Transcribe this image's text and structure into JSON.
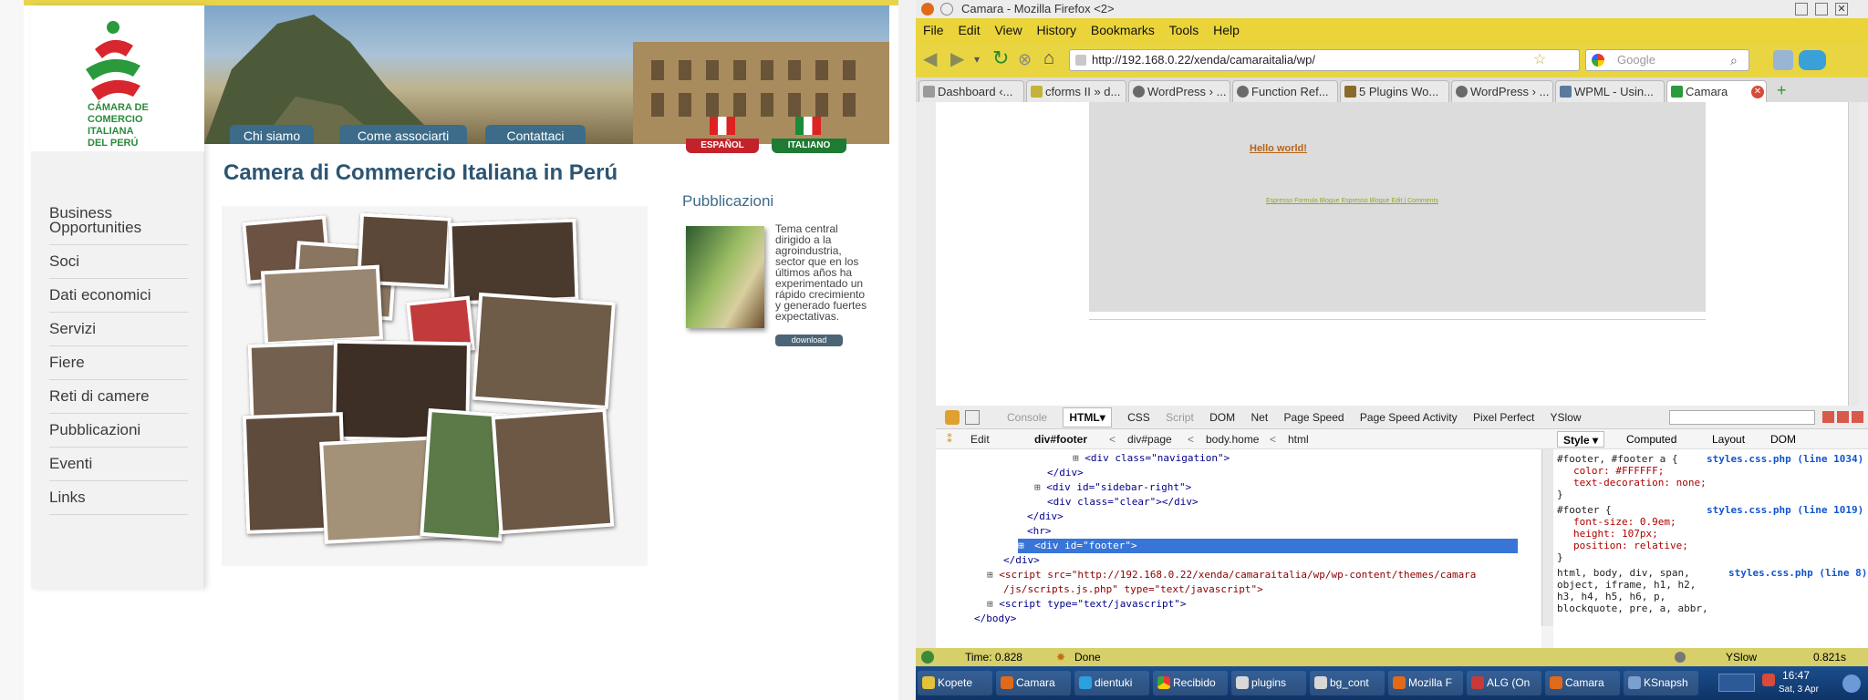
{
  "site": {
    "logo": {
      "line1": "CÁMARA DE",
      "line2": "COMERCIO",
      "line3": "ITALIANA",
      "line4": "DEL PERÚ"
    },
    "nav_tabs": [
      "Chi siamo",
      "Come associarti",
      "Contattaci"
    ],
    "languages": [
      "ESPAÑOL",
      "ITALIANO"
    ],
    "sidebar": [
      "Business Opportunities",
      "Soci",
      "Dati economici",
      "Servizi",
      "Fiere",
      "Reti di camere",
      "Pubblicazioni",
      "Eventi",
      "Links"
    ],
    "title": "Camera di Commercio Italiana in Perú",
    "publications": {
      "title": "Pubblicazioni",
      "description": "Tema central dirigido a la agroindustria, sector que en los últimos años ha experimentado un rápido crecimiento y generado fuertes expectativas.",
      "download": "download"
    }
  },
  "firefox": {
    "window_title": "Camara - Mozilla Firefox <2>",
    "menu": [
      "File",
      "Edit",
      "View",
      "History",
      "Bookmarks",
      "Tools",
      "Help"
    ],
    "url": "http://192.168.0.22/xenda/camaraitalia/wp/",
    "search_placeholder": "Google",
    "tabs": [
      "Dashboard ‹...",
      "cforms II » d...",
      "WordPress › ...",
      "Function Ref...",
      "5 Plugins Wo...",
      "WordPress › ...",
      "WPML - Usin...",
      "Camara"
    ],
    "page": {
      "hello": "Hello world!",
      "links": "Espresso Formula Blogue Espresso Blogue  Edit  | Comments"
    },
    "devtools": {
      "tabs": [
        "Console",
        "HTML",
        "CSS",
        "Script",
        "DOM",
        "Net",
        "Page Speed",
        "Page Speed Activity",
        "Pixel Perfect",
        "YSlow"
      ],
      "edit": "Edit",
      "breadcrumb": [
        "div#footer",
        "div#page",
        "body.home",
        "html"
      ],
      "side_tabs": [
        "Style",
        "Computed",
        "Layout",
        "DOM"
      ],
      "html_lines": [
        "<div class=\"navigation\">",
        "</div>",
        "<div id=\"sidebar-right\">",
        "<div class=\"clear\"></div>",
        "</div>",
        "<hr>",
        "<div id=\"footer\">",
        "</div>",
        "<script src=\"http://192.168.0.22/xenda/camaraitalia/wp/wp-content/themes/camara",
        "/js/scripts.js.php\" type=\"text/javascript\">",
        "<script type=\"text/javascript\">",
        "</body>"
      ],
      "styles": [
        {
          "selector": "#footer, #footer a {",
          "source": "styles.css.php (line 1034)",
          "rules": [
            "color: #FFFFFF;",
            "text-decoration: none;"
          ]
        },
        {
          "selector": "#footer {",
          "source": "styles.css.php (line 1019)",
          "rules": [
            "font-size: 0.9em;",
            "height: 107px;",
            "position: relative;"
          ]
        },
        {
          "selector": "html, body, div, span,",
          "source": "styles.css.php (line 8)",
          "rules": [
            "object, iframe, h1, h2,",
            "h3, h4, h5, h6, p,",
            "blockquote, pre, a, abbr,"
          ]
        }
      ]
    },
    "status": {
      "time": "Time: 0.828",
      "done": "Done",
      "yslow": "YSlow",
      "speed": "0.821s"
    },
    "taskbar": {
      "items": [
        "Kopete",
        "Camara",
        "dientuki",
        "Recibido",
        "plugins",
        "bg_cont",
        "Mozilla F",
        "ALG (On",
        "Camara",
        "KSnapsh"
      ],
      "time": "16:47",
      "date": "Sat, 3 Apr"
    }
  },
  "colors": {
    "menubar": "#ead43a",
    "link_hello": "#b4651a",
    "selected_row": "#3875d7",
    "taskbar": "#1b4e8e"
  }
}
